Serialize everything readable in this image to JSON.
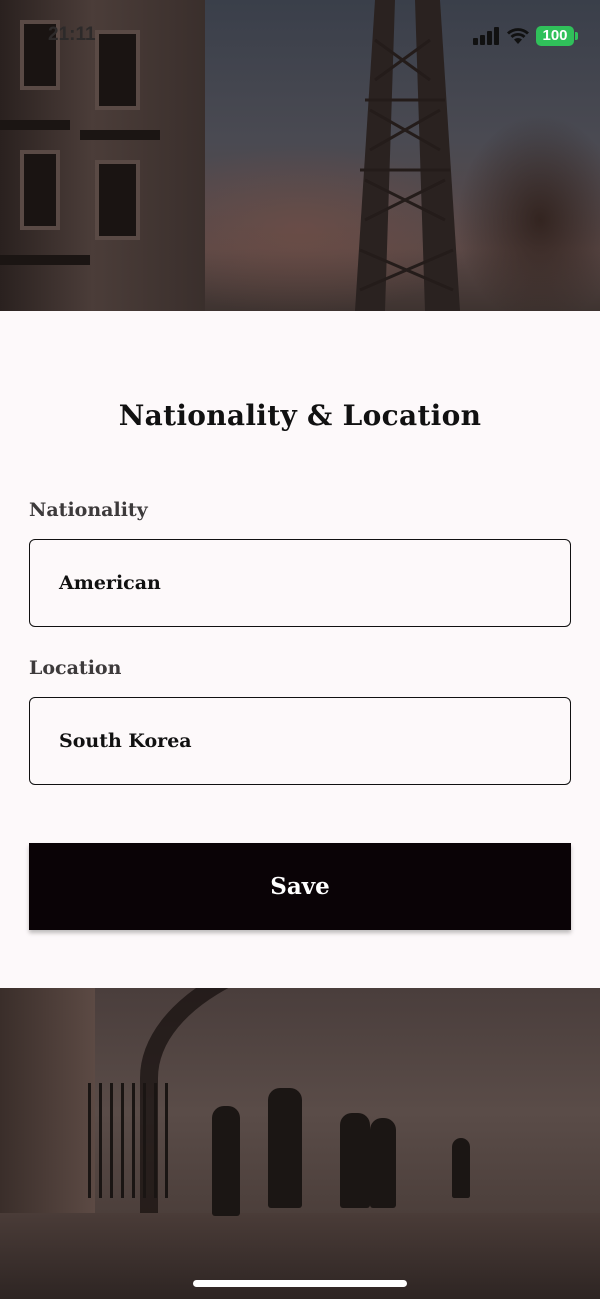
{
  "status_bar": {
    "time": "21:11",
    "battery": "100",
    "battery_color": "#30c05a"
  },
  "form": {
    "title": "Nationality & Location",
    "nationality_label": "Nationality",
    "nationality_value": "American",
    "location_label": "Location",
    "location_value": "South Korea",
    "save_label": "Save"
  },
  "colors": {
    "button_bg": "#0a0306",
    "card_bg": "#fdf9fa"
  }
}
